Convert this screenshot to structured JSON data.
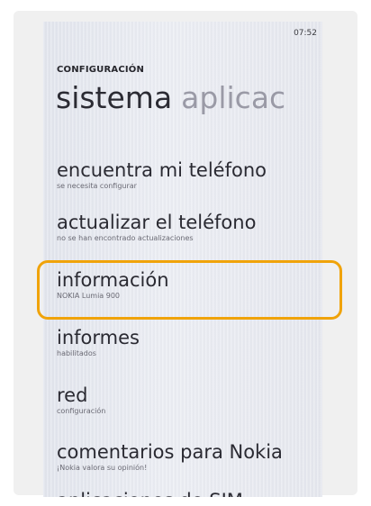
{
  "status": {
    "time": "07:52"
  },
  "header": {
    "title": "CONFIGURACIÓN",
    "pivot_active": "sistema",
    "pivot_next": "aplicac"
  },
  "items": [
    {
      "title": "encuentra mi teléfono",
      "subtitle": "se necesita configurar"
    },
    {
      "title": "actualizar el teléfono",
      "subtitle": "no se han encontrado actualizaciones"
    },
    {
      "title": "información",
      "subtitle": "NOKIA Lumia 900"
    },
    {
      "title": "informes",
      "subtitle": "habilitados"
    },
    {
      "title": "red",
      "subtitle": "configuración"
    },
    {
      "title": "comentarios para Nokia",
      "subtitle": "¡Nokia valora su opinión!"
    },
    {
      "title": "aplicaciones de SIM",
      "subtitle": ""
    }
  ],
  "annotation": {
    "color": "#f0a30a"
  }
}
